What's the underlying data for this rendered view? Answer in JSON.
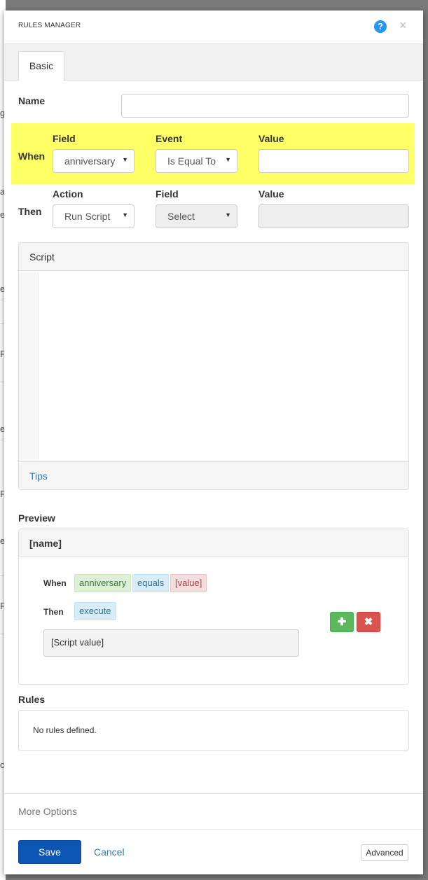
{
  "background": {
    "peek_chars": [
      "g",
      "a",
      "e",
      "e",
      "F",
      "e",
      "F",
      "e",
      "F",
      "ct"
    ]
  },
  "modal": {
    "title": "RULES MANAGER",
    "help_icon": "question-icon",
    "close_icon": "close-icon",
    "close_glyph": "×",
    "help_glyph": "?"
  },
  "tabs": [
    {
      "label": "Basic",
      "active": true
    }
  ],
  "form": {
    "name_label": "Name",
    "name_value": "",
    "when": {
      "row_label": "When",
      "field_label": "Field",
      "field_value": "anniversary",
      "event_label": "Event",
      "event_value": "Is Equal To",
      "value_label": "Value",
      "value_value": "",
      "highlight_color": "#ffff66"
    },
    "then": {
      "row_label": "Then",
      "action_label": "Action",
      "action_value": "Run Script",
      "field_label": "Field",
      "field_value": "Select",
      "value_label": "Value",
      "value_value": ""
    }
  },
  "script_panel": {
    "title": "Script",
    "content": "",
    "tips_link": "Tips"
  },
  "preview": {
    "heading": "Preview",
    "rule_name": "[name]",
    "when_label": "When",
    "when_tags": [
      "anniversary",
      "equals",
      "[value]"
    ],
    "then_label": "Then",
    "then_tags": [
      "execute"
    ],
    "script_value": "[Script value]",
    "add_icon": "plus-icon",
    "add_glyph": "✚",
    "remove_icon": "times-icon",
    "remove_glyph": "✖"
  },
  "rules": {
    "heading": "Rules",
    "empty_text": "No rules defined."
  },
  "more_options": "More Options",
  "footer": {
    "save": "Save",
    "cancel": "Cancel",
    "advanced": "Advanced"
  },
  "colors": {
    "primary": "#0d56b4",
    "success": "#5cb85c",
    "danger": "#d9534f",
    "help": "#2196f3"
  }
}
